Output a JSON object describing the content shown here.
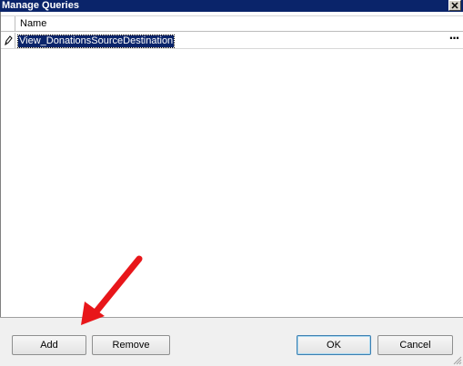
{
  "window": {
    "title": "Manage Queries",
    "close_symbol": "✕"
  },
  "grid": {
    "column_header": "Name",
    "rows": [
      {
        "name": "View_DonationsSourceDestination",
        "ellipsis": "···"
      }
    ]
  },
  "buttons": {
    "add": "Add",
    "remove": "Remove",
    "ok": "OK",
    "cancel": "Cancel"
  },
  "icons": {
    "row_edit": "pencil-icon",
    "close": "close-icon",
    "resize": "resize-grip-icon",
    "annotation": "red-arrow-icon"
  },
  "colors": {
    "title_bar": "#0a246a",
    "selection": "#0a246a",
    "annotation_arrow": "#e8161a"
  }
}
